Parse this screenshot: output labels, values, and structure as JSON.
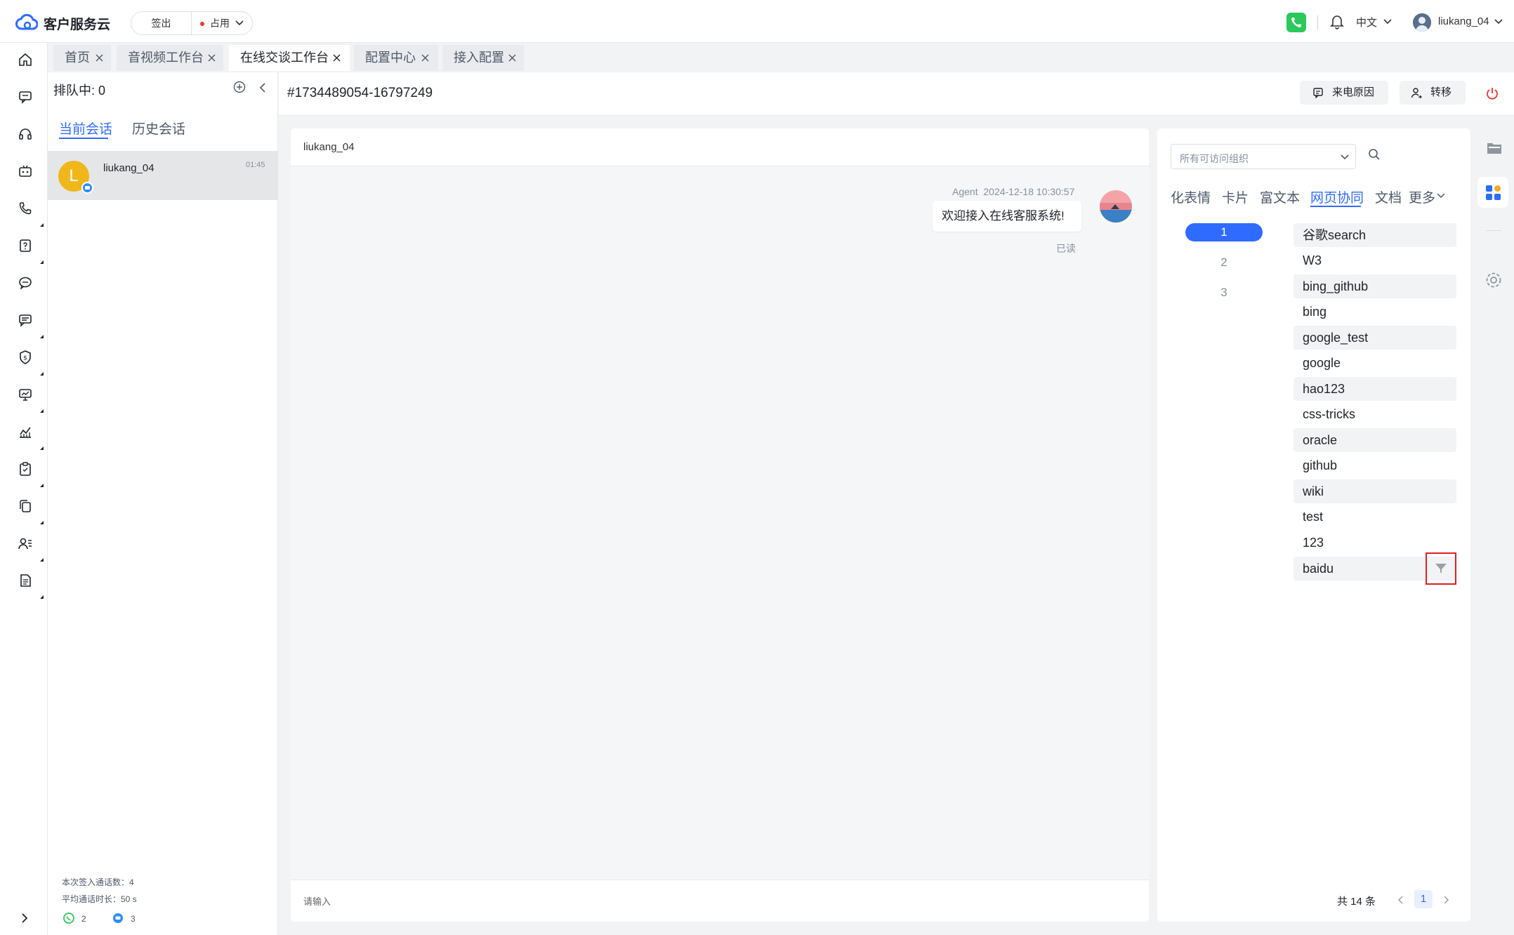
{
  "app": {
    "title": "客户服务云"
  },
  "status": {
    "signout_label": "签出",
    "busy_label": "占用"
  },
  "header": {
    "language": "中文",
    "username": "liukang_04"
  },
  "tabs": [
    {
      "label": "首页"
    },
    {
      "label": "音视频工作台"
    },
    {
      "label": "在线交谈工作台",
      "active": true
    },
    {
      "label": "配置中心"
    },
    {
      "label": "接入配置"
    }
  ],
  "nav": {
    "icons": [
      "home-icon",
      "chat-bubble-icon",
      "headset-icon",
      "robot-icon",
      "phone-icon",
      "question-doc-icon",
      "message-circle-icon",
      "comment-icon",
      "shield-icon",
      "monitor-chart-icon",
      "line-chart-icon",
      "clipboard-icon",
      "copy-icon",
      "user-list-icon",
      "document-icon"
    ]
  },
  "session_panel": {
    "queue_label": "排队中: 0",
    "tab_current": "当前会话",
    "tab_history": "历史会话",
    "sessions": [
      {
        "avatar_letter": "L",
        "name": "liukang_04",
        "time": "01:45"
      }
    ],
    "stats": {
      "sign_in_calls": "本次签入通话数：4",
      "avg_duration": "平均通话时长：50 s",
      "whatsapp_count": "2",
      "chat_count": "3"
    }
  },
  "conversation": {
    "id": "#1734489054-16797249",
    "call_reason_label": "来电原因",
    "transfer_label": "转移",
    "chat_title": "liukang_04",
    "message": {
      "sender": "Agent",
      "timestamp": "2024-12-18 10:30:57",
      "text": "欢迎接入在线客服系统!",
      "read_status": "已读"
    },
    "input_placeholder": "请输入"
  },
  "right_panel": {
    "org_select": "所有可访问组织",
    "tabs": [
      "化表情",
      "卡片",
      "富文本",
      "网页协同",
      "文档",
      "更多"
    ],
    "active_tab": "网页协同",
    "pages": [
      "1",
      "2",
      "3"
    ],
    "links": [
      "谷歌search",
      "W3",
      "bing_github",
      "bing",
      "google_test",
      "google",
      "hao123",
      "css-tricks",
      "oracle",
      "github",
      "wiki",
      "test",
      "123",
      "baidu"
    ],
    "total": "共 14 条",
    "current_page": "1"
  },
  "colors": {
    "accent": "#2f6bff",
    "avatar": "#f0b71b",
    "phone_green": "#2bc85b",
    "highlight_red": "#e02020"
  }
}
